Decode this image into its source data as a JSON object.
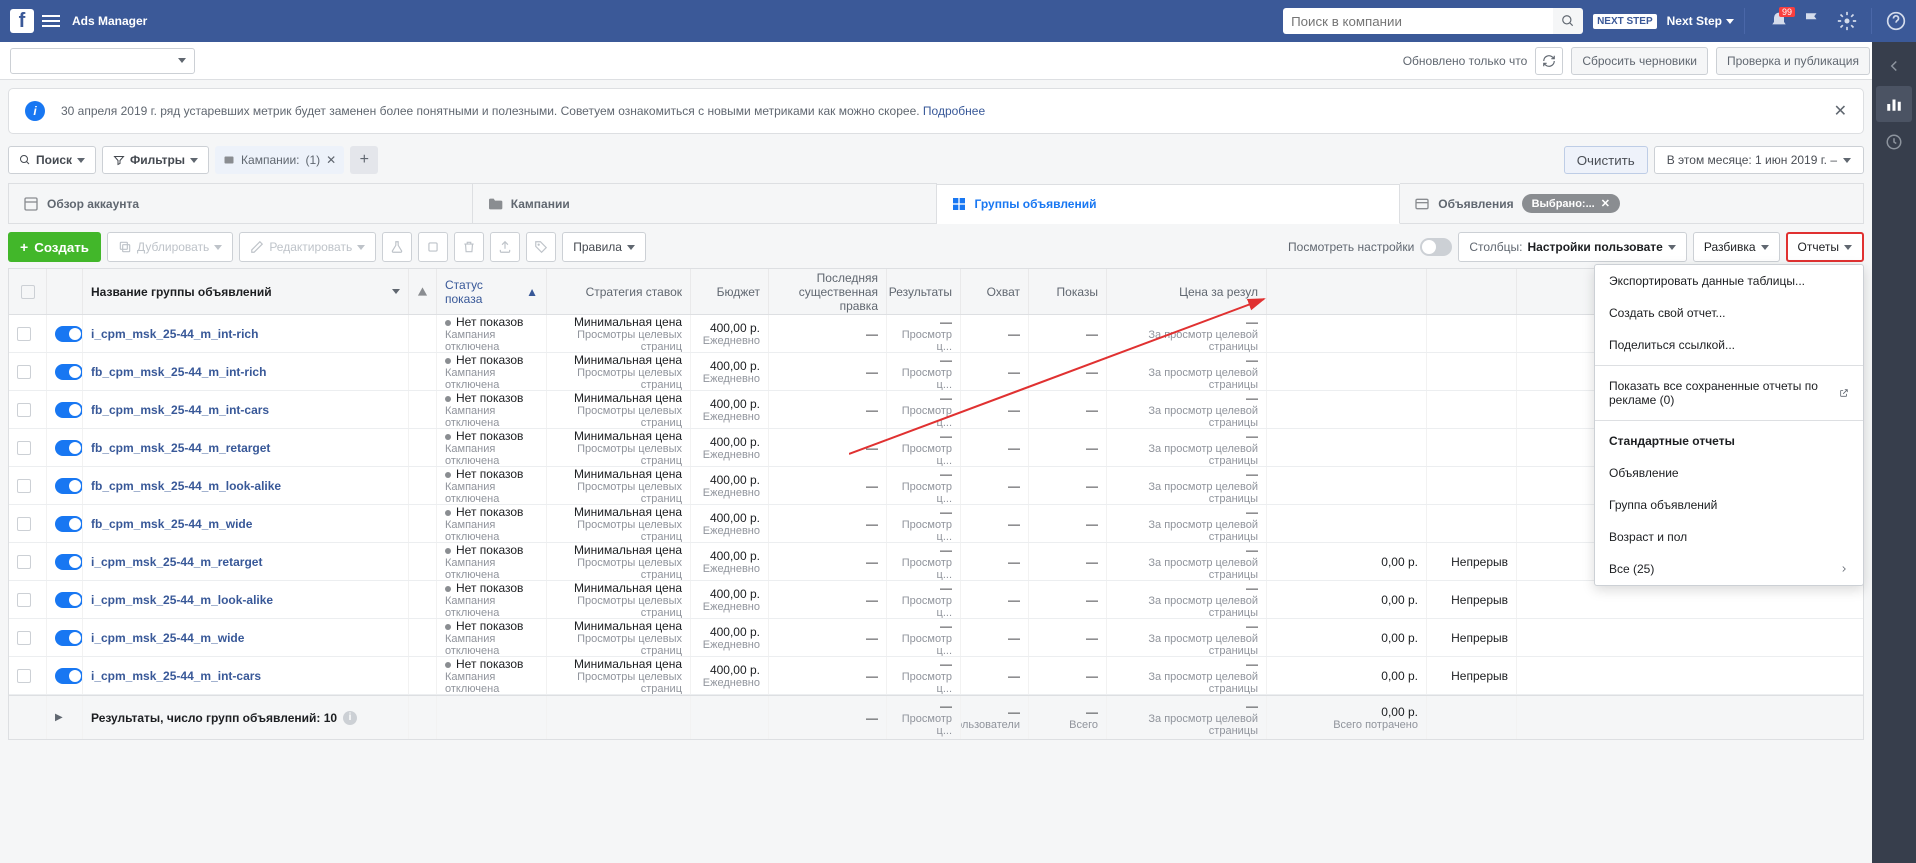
{
  "topbar": {
    "title": "Ads Manager",
    "search_placeholder": "Поиск в компании",
    "account_chip": "NEXT STEP",
    "account_name": "Next Step",
    "bell_badge": "99"
  },
  "subbar": {
    "updated": "Обновлено только что",
    "reset_drafts": "Сбросить черновики",
    "review_publish": "Проверка и публикация"
  },
  "alert": {
    "text": "30 апреля 2019 г. ряд устаревших метрик будет заменен более понятными и полезными. Советуем ознакомиться с новыми метриками как можно скорее. ",
    "link": "Подробнее"
  },
  "filters": {
    "search": "Поиск",
    "filters": "Фильтры",
    "chip_label": "Кампании:",
    "chip_count": "(1)",
    "clear": "Очистить",
    "date_range": "В этом месяце: 1 июн 2019 г. –"
  },
  "tabs": {
    "overview": "Обзор аккаунта",
    "campaigns": "Кампании",
    "adsets": "Группы объявлений",
    "ads": "Объявления",
    "selected": "Выбрано:..."
  },
  "toolbar": {
    "create": "Создать",
    "duplicate": "Дублировать",
    "edit": "Редактировать",
    "rules": "Правила",
    "view_settings": "Посмотреть настройки",
    "columns_label": "Столбцы:",
    "columns_value": "Настройки пользовате",
    "breakdown": "Разбивка",
    "reports": "Отчеты"
  },
  "reports_menu": {
    "export": "Экспортировать данные таблицы...",
    "create": "Создать свой отчет...",
    "share": "Поделиться ссылкой...",
    "saved": "Показать все сохраненные отчеты по рекламе (0)",
    "header": "Стандартные отчеты",
    "ad": "Объявление",
    "adset": "Группа объявлений",
    "age_gender": "Возраст и пол",
    "all": "Все (25)"
  },
  "columns": {
    "name": "Название группы объявлений",
    "status": "Статус показа",
    "strategy": "Стратегия ставок",
    "budget": "Бюджет",
    "last_edit": "Последняя существенная правка",
    "results": "Результаты",
    "reach": "Охват",
    "impressions": "Показы",
    "cost": "Цена за резул",
    "spend": "",
    "end": ""
  },
  "shared": {
    "status_main": "Нет показов",
    "status_sub": "Кампания отключена",
    "strategy_main": "Минимальная цена",
    "strategy_sub": "Просмотры целевых страниц",
    "budget_main": "400,00 р.",
    "budget_sub": "Ежедневно",
    "results_sub": "Просмотр ц...",
    "cost_sub": "За просмотр целевой страницы",
    "end_text": "Непрерыв"
  },
  "rows": [
    {
      "name": "i_cpm_msk_25-44_m_int-rich",
      "spend": "",
      "end": ""
    },
    {
      "name": "fb_cpm_msk_25-44_m_int-rich",
      "spend": "",
      "end": ""
    },
    {
      "name": "fb_cpm_msk_25-44_m_int-cars",
      "spend": "",
      "end": ""
    },
    {
      "name": "fb_cpm_msk_25-44_m_retarget",
      "spend": "",
      "end": ""
    },
    {
      "name": "fb_cpm_msk_25-44_m_look-alike",
      "spend": "",
      "end": ""
    },
    {
      "name": "fb_cpm_msk_25-44_m_wide",
      "spend": "",
      "end": ""
    },
    {
      "name": "i_cpm_msk_25-44_m_retarget",
      "spend": "0,00 р.",
      "end": "Непрерыв"
    },
    {
      "name": "i_cpm_msk_25-44_m_look-alike",
      "spend": "0,00 р.",
      "end": "Непрерыв"
    },
    {
      "name": "i_cpm_msk_25-44_m_wide",
      "spend": "0,00 р.",
      "end": "Непрерыв"
    },
    {
      "name": "i_cpm_msk_25-44_m_int-cars",
      "spend": "0,00 р.",
      "end": "Непрерыв"
    }
  ],
  "footer": {
    "label": "Результаты, число групп объявлений: 10",
    "results_sub": "Просмотр ц...",
    "reach_sub": "Пользователи",
    "impr_sub": "Всего",
    "cost_sub": "За просмотр целевой страницы",
    "spend": "0,00 р.",
    "spend_sub": "Всего потрачено"
  }
}
